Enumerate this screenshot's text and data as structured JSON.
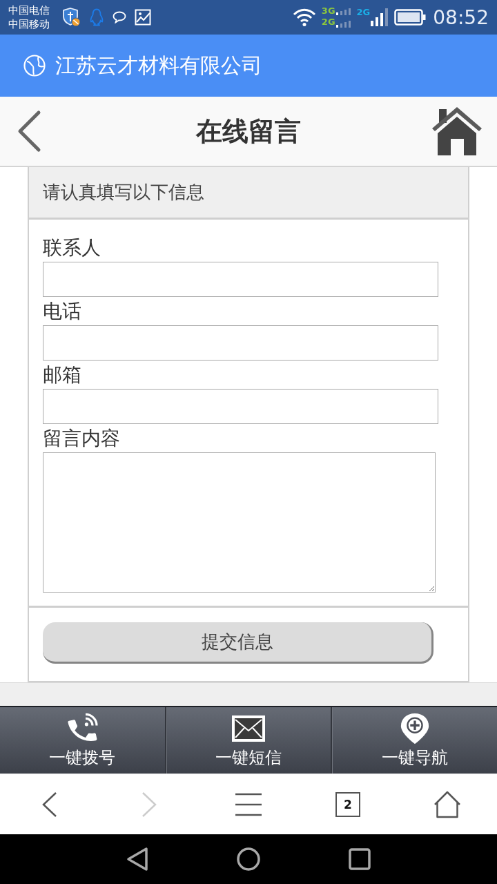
{
  "status_bar": {
    "carriers": [
      "中国电信",
      "中国移动"
    ],
    "sims": [
      {
        "network_types": [
          "3G",
          "2G"
        ],
        "color": "#8cc63f"
      },
      {
        "network_types": [
          "2G"
        ],
        "color": "#1ab0e8"
      }
    ],
    "time": "08:52"
  },
  "app_header": {
    "title": "江苏云才材料有限公司"
  },
  "nav_bar": {
    "title": "在线留言"
  },
  "form": {
    "heading": "请认真填写以下信息",
    "fields": [
      {
        "label": "联系人",
        "kind": "input"
      },
      {
        "label": "电话",
        "kind": "input"
      },
      {
        "label": "邮箱",
        "kind": "input"
      },
      {
        "label": "留言内容",
        "kind": "textarea"
      }
    ],
    "submit": "提交信息"
  },
  "action_bar": [
    {
      "label": "一键拨号"
    },
    {
      "label": "一键短信"
    },
    {
      "label": "一键导航"
    }
  ],
  "browser_toolbar": [
    {
      "kind": "back",
      "disabled": false
    },
    {
      "kind": "forward",
      "disabled": true
    },
    {
      "kind": "menu",
      "disabled": false
    },
    {
      "kind": "tabs",
      "label": "2",
      "disabled": false
    },
    {
      "kind": "home",
      "disabled": false
    }
  ]
}
